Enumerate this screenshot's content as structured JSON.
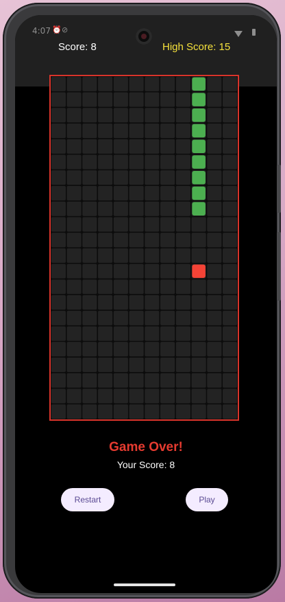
{
  "status_bar": {
    "time": "4:07",
    "icons": [
      "alarm-icon",
      "do-not-disturb-icon",
      "wifi-icon",
      "battery-icon"
    ]
  },
  "header": {
    "score_label": "Score: 8",
    "high_score_label": "High Score: 15"
  },
  "board": {
    "columns": 12,
    "rows": 22,
    "cell_color": "#232323",
    "border_color": "#d9342b",
    "snake_color": "#4caf50",
    "food_color": "#f44336",
    "snake": [
      [
        9,
        0
      ],
      [
        9,
        1
      ],
      [
        9,
        2
      ],
      [
        9,
        3
      ],
      [
        9,
        4
      ],
      [
        9,
        5
      ],
      [
        9,
        6
      ],
      [
        9,
        7
      ],
      [
        9,
        8
      ]
    ],
    "food": [
      9,
      12
    ]
  },
  "game_over": {
    "title": "Game Over!",
    "score_text": "Your Score: 8"
  },
  "buttons": {
    "restart_label": "Restart",
    "play_label": "Play"
  }
}
